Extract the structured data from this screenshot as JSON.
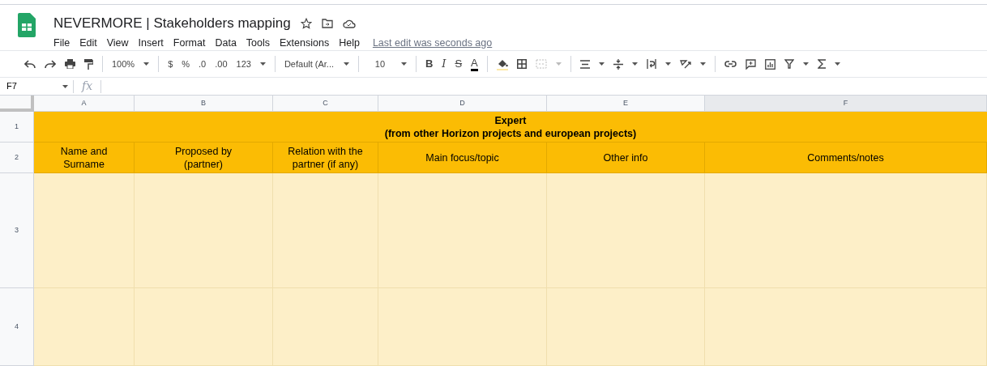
{
  "document": {
    "title": "NEVERMORE | Stakeholders mapping",
    "last_edit": "Last edit was seconds ago"
  },
  "menu": [
    "File",
    "Edit",
    "View",
    "Insert",
    "Format",
    "Data",
    "Tools",
    "Extensions",
    "Help"
  ],
  "toolbar": {
    "zoom": "100%",
    "currency": "$",
    "percent": "%",
    "decrease_decimal": ".0",
    "increase_decimal": ".00",
    "number_format": "123",
    "font": "Default (Ar...",
    "font_size": "10",
    "bold": "B",
    "italic": "I",
    "strikethrough": "S",
    "text_color": "A"
  },
  "formula_bar": {
    "cell_ref": "F7",
    "fx": "fx"
  },
  "columns": [
    {
      "label": "A",
      "selected": false
    },
    {
      "label": "B",
      "selected": false
    },
    {
      "label": "C",
      "selected": false
    },
    {
      "label": "D",
      "selected": false
    },
    {
      "label": "E",
      "selected": false
    },
    {
      "label": "F",
      "selected": true
    }
  ],
  "rows": [
    {
      "number": "1",
      "merged": "Expert\n(from other Horizon projects and european projects)"
    },
    {
      "number": "2",
      "cells": [
        "Name and\nSurname",
        "Proposed by\n(partner)",
        "Relation with the\npartner (if any)",
        "Main focus/topic",
        "Other info",
        "Comments/notes"
      ]
    },
    {
      "number": "3",
      "cells": []
    },
    {
      "number": "4",
      "cells": []
    }
  ]
}
